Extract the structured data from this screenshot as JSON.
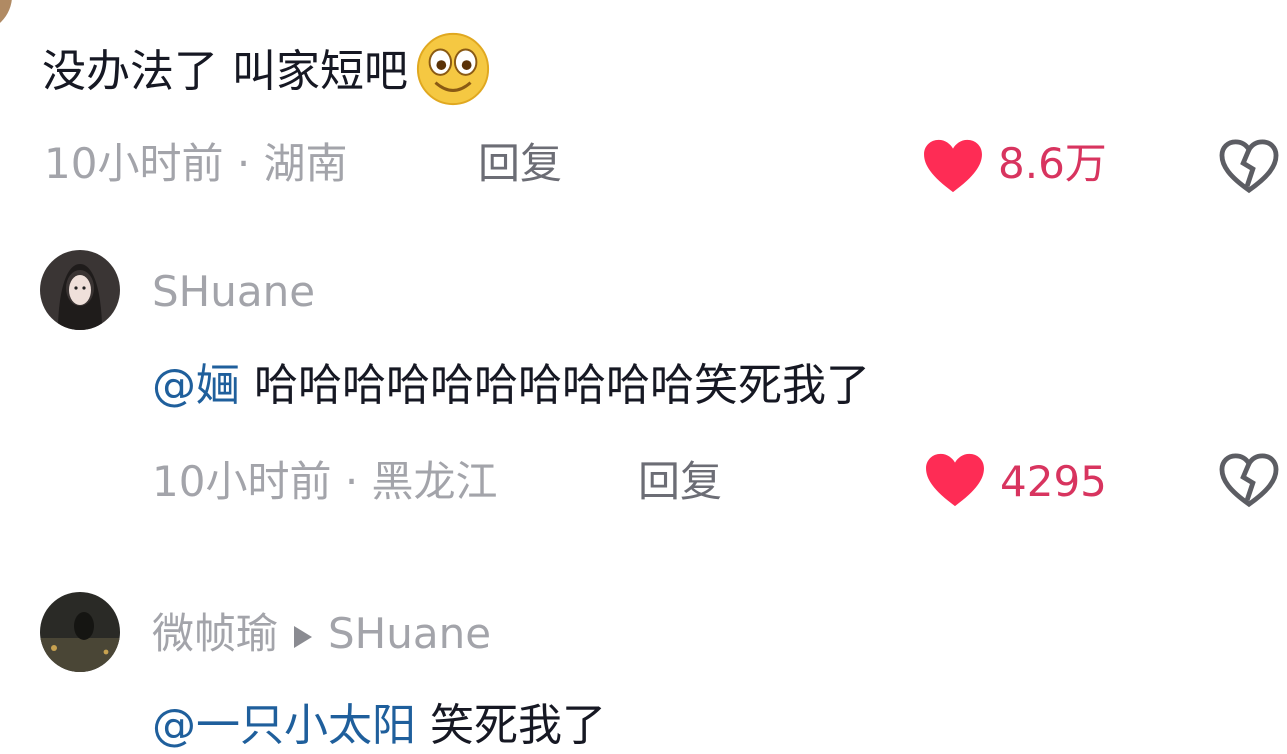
{
  "comment1": {
    "text": "没办法了 叫家短吧",
    "emoji": "smiling-face-emoji",
    "time": "10小时前",
    "separator": "·",
    "location": "湖南",
    "reply_label": "回复",
    "likes": "8.6万"
  },
  "comment2": {
    "username": "SHuane",
    "mention": "@婳",
    "text": "哈哈哈哈哈哈哈哈哈哈笑死我了",
    "time": "10小时前",
    "separator": "·",
    "location": "黑龙江",
    "reply_label": "回复",
    "likes": "4295"
  },
  "comment3": {
    "username": "微帧瑜",
    "reply_to": "SHuane",
    "mention": "@一只小太阳",
    "text": "笑死我了"
  },
  "colors": {
    "like": "#fe2c55",
    "mention": "#1f5f9c",
    "meta": "#a3a4aa"
  },
  "icons": [
    "heart-icon",
    "broken-heart-icon",
    "reply-arrow-icon"
  ]
}
